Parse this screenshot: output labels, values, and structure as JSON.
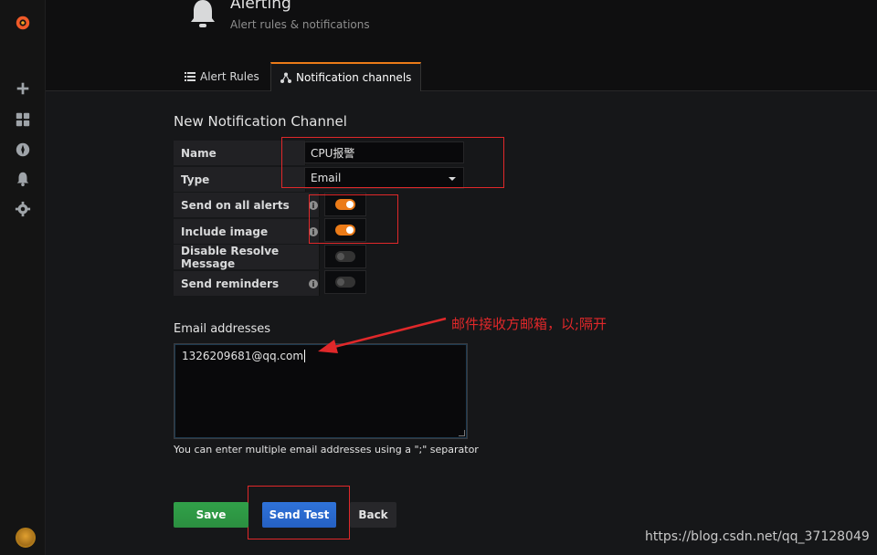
{
  "header": {
    "title": "Alerting",
    "subtitle": "Alert rules & notifications"
  },
  "tabs": [
    {
      "label": "Alert Rules",
      "icon": "list-icon",
      "active": false
    },
    {
      "label": "Notification channels",
      "icon": "channels-icon",
      "active": true
    }
  ],
  "sidebar": {
    "items": [
      {
        "icon": "grafana-logo-icon"
      },
      {
        "icon": "plus-icon"
      },
      {
        "icon": "dashboards-icon"
      },
      {
        "icon": "explore-icon"
      },
      {
        "icon": "bell-icon"
      },
      {
        "icon": "gear-icon"
      }
    ],
    "avatar": "user-avatar"
  },
  "form": {
    "section_title": "New Notification Channel",
    "name_label": "Name",
    "name_value": "CPU报警",
    "type_label": "Type",
    "type_value": "Email",
    "send_all_label": "Send on all alerts",
    "send_all_on": true,
    "include_image_label": "Include image",
    "include_image_on": true,
    "disable_resolve_label": "Disable Resolve Message",
    "disable_resolve_on": false,
    "send_reminders_label": "Send reminders",
    "send_reminders_on": false,
    "email_label": "Email addresses",
    "email_value": "1326209681@qq.com",
    "help_text": "You can enter multiple email addresses using a \";\" separator"
  },
  "buttons": {
    "save": "Save",
    "send_test": "Send Test",
    "back": "Back"
  },
  "annotation": "邮件接收方邮箱，以;隔开",
  "watermark": "https://blog.csdn.net/qq_37128049",
  "colors": {
    "accent": "#eb7b18",
    "save": "#2b8f40",
    "send_test": "#2560c3",
    "highlight": "#e0282a"
  }
}
